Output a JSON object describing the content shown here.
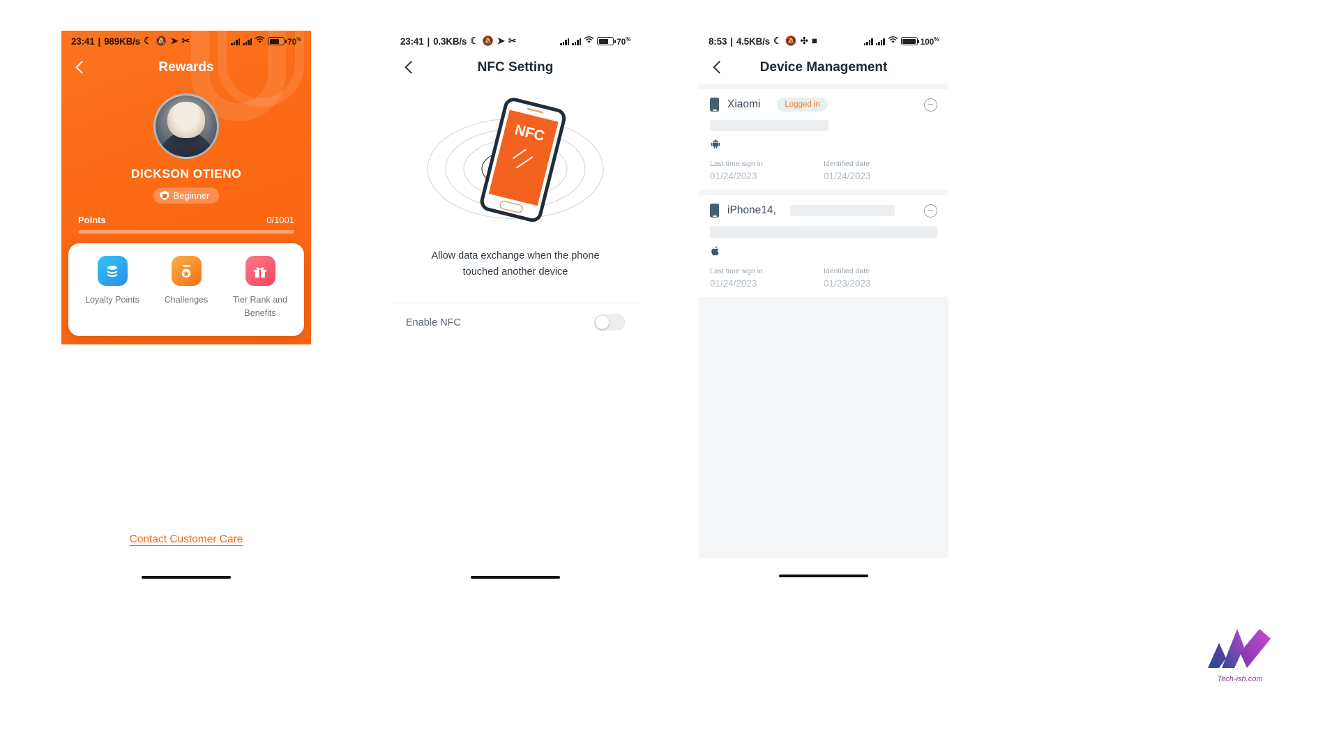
{
  "screen1": {
    "status": {
      "time": "23:41",
      "net_speed": "989KB/s",
      "battery_pct": "70",
      "pct_symbol": "%"
    },
    "nav": {
      "title": "Rewards",
      "back": "back-arrow"
    },
    "profile": {
      "name": "DICKSON OTIENO",
      "tier_label": "Beginner",
      "points_label": "Points",
      "points_value": "0/1001"
    },
    "quick_actions": [
      {
        "label": "Loyalty Points",
        "icon": "coins-stack-icon"
      },
      {
        "label": "Challenges",
        "icon": "medal-icon"
      },
      {
        "label": "Tier Rank and Benefits",
        "icon": "gift-icon"
      }
    ],
    "footer_link": "Contact Customer Care",
    "accent": "#fb6a15"
  },
  "screen2": {
    "status": {
      "time": "23:41",
      "net_speed": "0.3KB/s",
      "battery_pct": "70",
      "pct_symbol": "%"
    },
    "nav": {
      "title": "NFC Setting",
      "back": "back-arrow"
    },
    "illustration": {
      "label": "NFC",
      "name": "nfc-phone-illustration"
    },
    "description": "Allow data exchange when the phone touched another device",
    "toggle": {
      "label": "Enable NFC",
      "state": "off"
    },
    "accent": "#f4621f"
  },
  "screen3": {
    "status": {
      "time": "8:53",
      "net_speed": "4.5KB/s",
      "battery_pct": "100",
      "pct_symbol": "%"
    },
    "nav": {
      "title": "Device Management",
      "back": "back-arrow"
    },
    "meta_labels": {
      "last_sign_in": "Last time sign in",
      "identified_date": "Identified date"
    },
    "devices": [
      {
        "name": "Xiaomi",
        "badge": "Logged in",
        "os_icon": "android-icon",
        "last_sign_in": "01/24/2023",
        "identified_date": "01/24/2023"
      },
      {
        "name": "iPhone14,",
        "badge": "",
        "os_icon": "apple-icon",
        "last_sign_in": "01/24/2023",
        "identified_date": "01/23/2023"
      }
    ]
  },
  "watermark": {
    "text": "Tech-ish.com",
    "icon": "tech-ish-logo"
  }
}
